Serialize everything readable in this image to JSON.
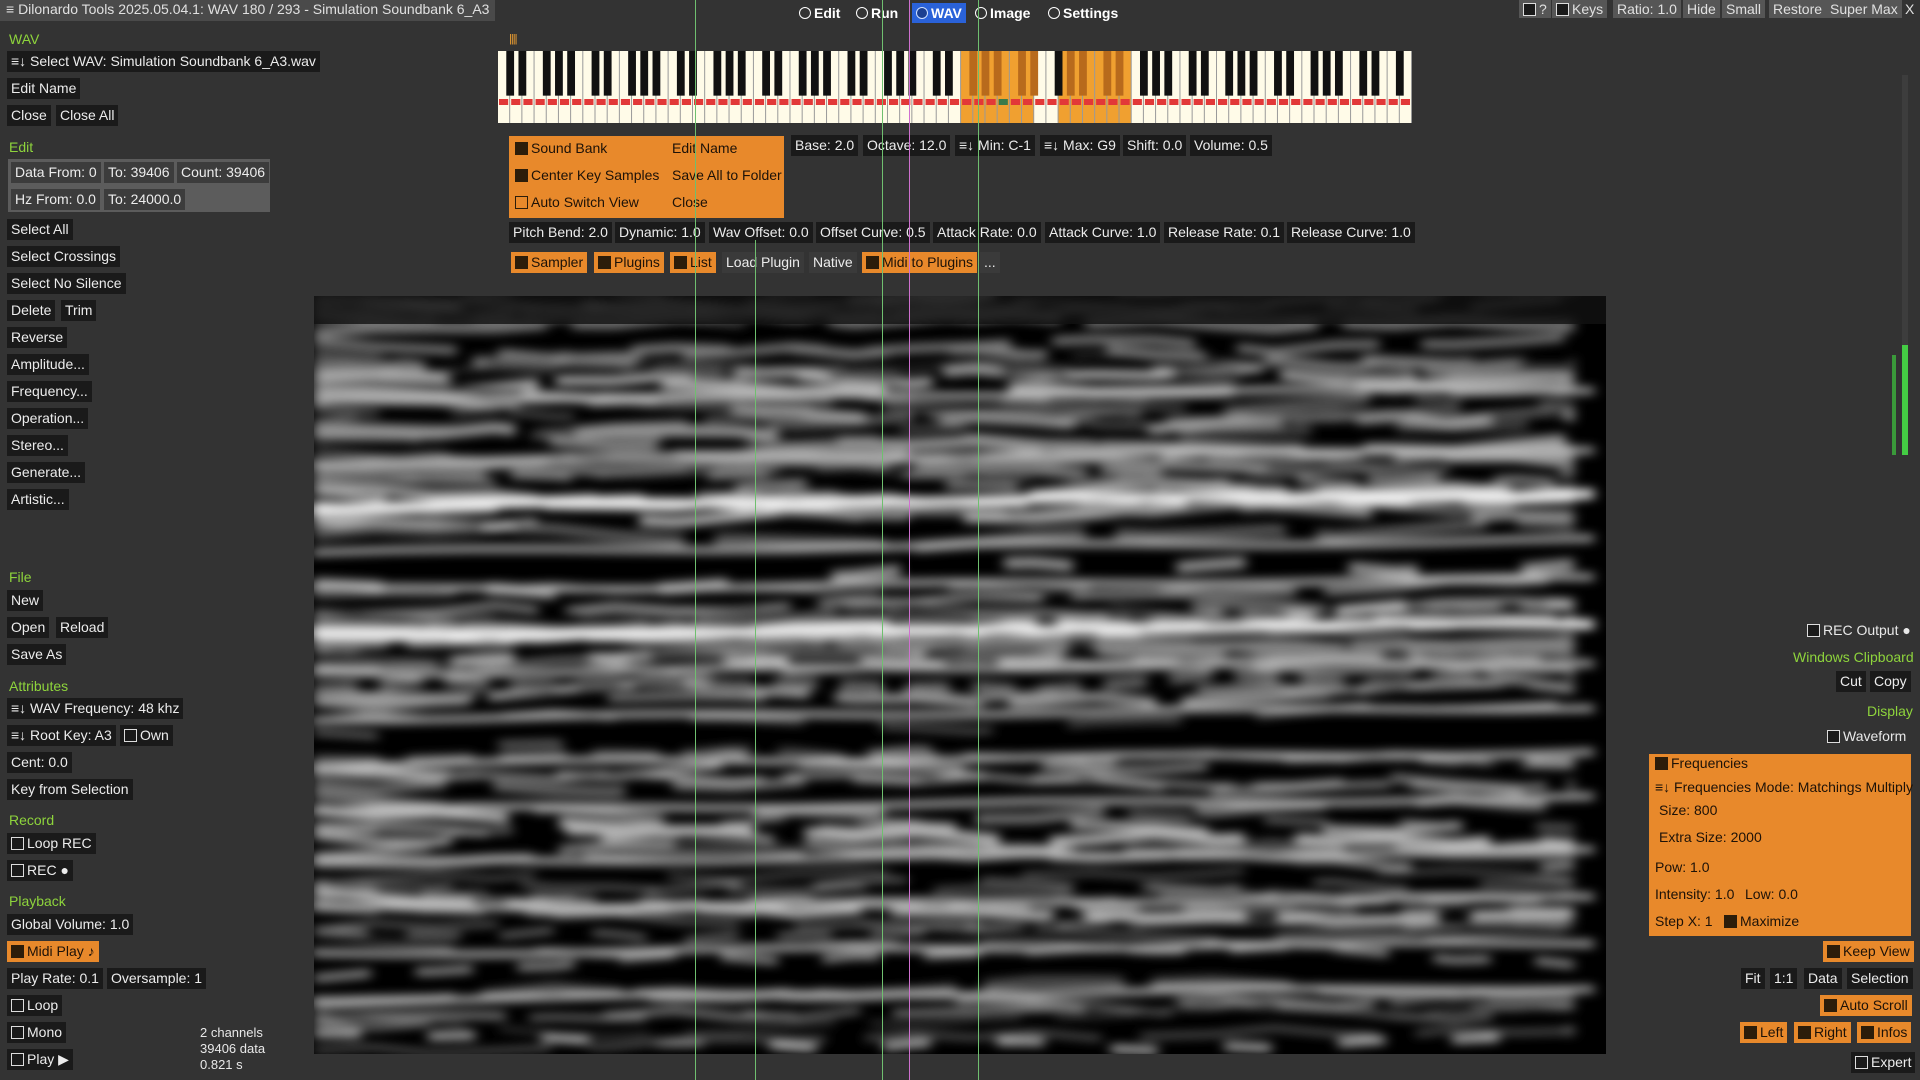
{
  "window": {
    "title": "Dilonardo Tools 2025.05.04.1: WAV 180 / 293 - Simulation Soundbank 6_A3"
  },
  "topbar": {
    "tabs": [
      {
        "label": "Edit",
        "selected": false
      },
      {
        "label": "Run",
        "selected": false
      },
      {
        "label": "WAV",
        "selected": true
      },
      {
        "label": "Image",
        "selected": false
      },
      {
        "label": "Settings",
        "selected": false
      }
    ],
    "right": {
      "help": "?",
      "keys": "Keys",
      "ratio": "Ratio: 1.0",
      "hide": "Hide",
      "small": "Small",
      "restore": "Restore",
      "super_max": "Super Max",
      "close": "X"
    }
  },
  "left": {
    "wav_section": "WAV",
    "select_wav": "≡↓ Select WAV: Simulation Soundbank 6_A3.wav",
    "edit_name": "Edit Name",
    "close": "Close",
    "close_all": "Close All",
    "edit_section": "Edit",
    "data_from": "Data From: 0",
    "data_to": "To: 39406",
    "data_count": "Count: 39406",
    "hz_from": "Hz From: 0.0",
    "hz_to": "To: 24000.0",
    "select_all": "Select All",
    "select_crossings": "Select Crossings",
    "select_no_silence": "Select No Silence",
    "delete": "Delete",
    "trim": "Trim",
    "reverse": "Reverse",
    "amplitude": "Amplitude...",
    "frequency": "Frequency...",
    "operation": "Operation...",
    "stereo": "Stereo...",
    "generate": "Generate...",
    "artistic": "Artistic...",
    "file_section": "File",
    "new": "New",
    "open": "Open",
    "reload": "Reload",
    "save_as": "Save As",
    "attributes_section": "Attributes",
    "wav_frequency": "≡↓ WAV Frequency: 48 khz",
    "root_key": "≡↓ Root Key: A3",
    "own": "Own",
    "cent": "Cent: 0.0",
    "key_from_selection": "Key from Selection",
    "record_section": "Record",
    "loop_rec": "Loop REC",
    "rec": "REC ●",
    "playback_section": "Playback",
    "global_volume": "Global Volume: 1.0",
    "midi_play": "Midi Play ♪",
    "play_rate": "Play Rate: 0.1",
    "oversample": "Oversample: 1",
    "loop": "Loop",
    "mono": "Mono",
    "play": "Play ▶",
    "info_channels": "2 channels",
    "info_data": "39406 data",
    "info_seconds": "0.821 s"
  },
  "keyboard": {
    "octaves": 10,
    "marker": "||||",
    "highlight_color": "#f0a030",
    "selected_key_color": "#3a7a4a"
  },
  "sampler": {
    "sound_bank": "Sound Bank",
    "edit_name": "Edit Name",
    "center_key_samples": "Center Key Samples",
    "save_all_to_folder": "Save All to Folder",
    "auto_switch_view": "Auto Switch View",
    "close": "Close",
    "base": "Base: 2.0",
    "octave": "Octave: 12.0",
    "min": "≡↓ Min: C-1",
    "max": "≡↓ Max: G9",
    "shift": "Shift: 0.0",
    "volume": "Volume: 0.5",
    "pitch_bend": "Pitch Bend: 2.0",
    "dynamic": "Dynamic: 1.0",
    "wav_offset": "Wav Offset: 0.0",
    "offset_curve": "Offset Curve: 0.5",
    "attack_rate": "Attack Rate: 0.0",
    "attack_curve": "Attack Curve: 1.0",
    "release_rate": "Release Rate: 0.1",
    "release_curve": "Release Curve: 1.0",
    "tab_sampler": "Sampler",
    "tab_plugins": "Plugins",
    "tab_list": "List",
    "load_plugin": "Load Plugin",
    "native": "Native",
    "midi_to_plugins": "Midi to Plugins",
    "more": "..."
  },
  "right": {
    "rec_output": "REC Output ●",
    "clipboard_section": "Windows Clipboard",
    "cut": "Cut",
    "copy": "Copy",
    "display_section": "Display",
    "waveform": "Waveform",
    "frequencies": "Frequencies",
    "frequencies_mode": "≡↓ Frequencies Mode: Matchings Multiply",
    "size": "Size: 800",
    "extra_size": "Extra Size: 2000",
    "pow": "Pow: 1.0",
    "intensity": "Intensity: 1.0",
    "low": "Low: 0.0",
    "step_x": "Step X: 1",
    "maximize": "Maximize",
    "keep_view": "Keep View",
    "fit": "Fit",
    "one_to_one": "1:1",
    "data": "Data",
    "selection": "Selection",
    "auto_scroll": "Auto Scroll",
    "left": "Left",
    "right": "Right",
    "infos": "Infos",
    "expert": "Expert"
  },
  "spectrogram": {
    "bands": [
      0.13,
      0.21,
      0.27,
      0.33,
      0.38,
      0.44,
      0.49,
      0.55,
      0.61,
      0.67,
      0.74,
      0.8,
      0.86,
      0.92
    ]
  }
}
